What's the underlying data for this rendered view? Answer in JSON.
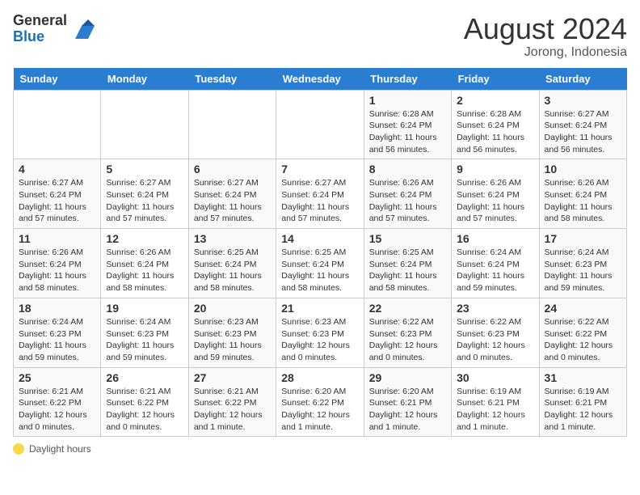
{
  "header": {
    "logo_line1": "General",
    "logo_line2": "Blue",
    "month_year": "August 2024",
    "location": "Jorong, Indonesia"
  },
  "days": [
    "Sunday",
    "Monday",
    "Tuesday",
    "Wednesday",
    "Thursday",
    "Friday",
    "Saturday"
  ],
  "weeks": [
    [
      {
        "date": "",
        "info": ""
      },
      {
        "date": "",
        "info": ""
      },
      {
        "date": "",
        "info": ""
      },
      {
        "date": "",
        "info": ""
      },
      {
        "date": "1",
        "info": "Sunrise: 6:28 AM\nSunset: 6:24 PM\nDaylight: 11 hours and 56 minutes."
      },
      {
        "date": "2",
        "info": "Sunrise: 6:28 AM\nSunset: 6:24 PM\nDaylight: 11 hours and 56 minutes."
      },
      {
        "date": "3",
        "info": "Sunrise: 6:27 AM\nSunset: 6:24 PM\nDaylight: 11 hours and 56 minutes."
      }
    ],
    [
      {
        "date": "4",
        "info": "Sunrise: 6:27 AM\nSunset: 6:24 PM\nDaylight: 11 hours and 57 minutes."
      },
      {
        "date": "5",
        "info": "Sunrise: 6:27 AM\nSunset: 6:24 PM\nDaylight: 11 hours and 57 minutes."
      },
      {
        "date": "6",
        "info": "Sunrise: 6:27 AM\nSunset: 6:24 PM\nDaylight: 11 hours and 57 minutes."
      },
      {
        "date": "7",
        "info": "Sunrise: 6:27 AM\nSunset: 6:24 PM\nDaylight: 11 hours and 57 minutes."
      },
      {
        "date": "8",
        "info": "Sunrise: 6:26 AM\nSunset: 6:24 PM\nDaylight: 11 hours and 57 minutes."
      },
      {
        "date": "9",
        "info": "Sunrise: 6:26 AM\nSunset: 6:24 PM\nDaylight: 11 hours and 57 minutes."
      },
      {
        "date": "10",
        "info": "Sunrise: 6:26 AM\nSunset: 6:24 PM\nDaylight: 11 hours and 58 minutes."
      }
    ],
    [
      {
        "date": "11",
        "info": "Sunrise: 6:26 AM\nSunset: 6:24 PM\nDaylight: 11 hours and 58 minutes."
      },
      {
        "date": "12",
        "info": "Sunrise: 6:26 AM\nSunset: 6:24 PM\nDaylight: 11 hours and 58 minutes."
      },
      {
        "date": "13",
        "info": "Sunrise: 6:25 AM\nSunset: 6:24 PM\nDaylight: 11 hours and 58 minutes."
      },
      {
        "date": "14",
        "info": "Sunrise: 6:25 AM\nSunset: 6:24 PM\nDaylight: 11 hours and 58 minutes."
      },
      {
        "date": "15",
        "info": "Sunrise: 6:25 AM\nSunset: 6:24 PM\nDaylight: 11 hours and 58 minutes."
      },
      {
        "date": "16",
        "info": "Sunrise: 6:24 AM\nSunset: 6:24 PM\nDaylight: 11 hours and 59 minutes."
      },
      {
        "date": "17",
        "info": "Sunrise: 6:24 AM\nSunset: 6:23 PM\nDaylight: 11 hours and 59 minutes."
      }
    ],
    [
      {
        "date": "18",
        "info": "Sunrise: 6:24 AM\nSunset: 6:23 PM\nDaylight: 11 hours and 59 minutes."
      },
      {
        "date": "19",
        "info": "Sunrise: 6:24 AM\nSunset: 6:23 PM\nDaylight: 11 hours and 59 minutes."
      },
      {
        "date": "20",
        "info": "Sunrise: 6:23 AM\nSunset: 6:23 PM\nDaylight: 11 hours and 59 minutes."
      },
      {
        "date": "21",
        "info": "Sunrise: 6:23 AM\nSunset: 6:23 PM\nDaylight: 12 hours and 0 minutes."
      },
      {
        "date": "22",
        "info": "Sunrise: 6:22 AM\nSunset: 6:23 PM\nDaylight: 12 hours and 0 minutes."
      },
      {
        "date": "23",
        "info": "Sunrise: 6:22 AM\nSunset: 6:23 PM\nDaylight: 12 hours and 0 minutes."
      },
      {
        "date": "24",
        "info": "Sunrise: 6:22 AM\nSunset: 6:22 PM\nDaylight: 12 hours and 0 minutes."
      }
    ],
    [
      {
        "date": "25",
        "info": "Sunrise: 6:21 AM\nSunset: 6:22 PM\nDaylight: 12 hours and 0 minutes."
      },
      {
        "date": "26",
        "info": "Sunrise: 6:21 AM\nSunset: 6:22 PM\nDaylight: 12 hours and 0 minutes."
      },
      {
        "date": "27",
        "info": "Sunrise: 6:21 AM\nSunset: 6:22 PM\nDaylight: 12 hours and 1 minute."
      },
      {
        "date": "28",
        "info": "Sunrise: 6:20 AM\nSunset: 6:22 PM\nDaylight: 12 hours and 1 minute."
      },
      {
        "date": "29",
        "info": "Sunrise: 6:20 AM\nSunset: 6:21 PM\nDaylight: 12 hours and 1 minute."
      },
      {
        "date": "30",
        "info": "Sunrise: 6:19 AM\nSunset: 6:21 PM\nDaylight: 12 hours and 1 minute."
      },
      {
        "date": "31",
        "info": "Sunrise: 6:19 AM\nSunset: 6:21 PM\nDaylight: 12 hours and 1 minute."
      }
    ]
  ],
  "footer": {
    "icon_label": "daylight-icon",
    "text": "Daylight hours"
  }
}
